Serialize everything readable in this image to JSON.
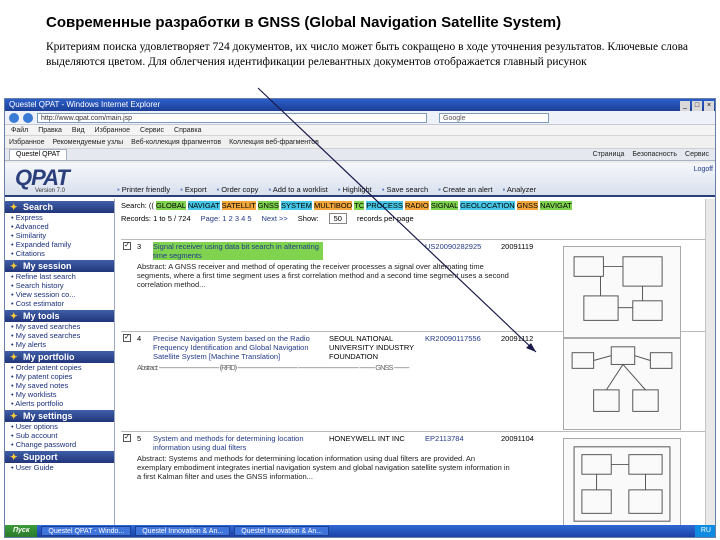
{
  "slide": {
    "title": "Современные разработки в  GNSS (Global Navigation Satellite System)",
    "description": "Критериям поиска удовлетворяет 724 документов, их число может быть сокращено в ходе уточнения результатов. Ключевые слова выделяются цветом. Для облегчения идентификации релевантных документов отображается главный рисунок"
  },
  "browser": {
    "window_title": "Questel QPAT - Windows Internet Explorer",
    "address": "http://www.qpat.com/main.jsp",
    "search_placeholder": "Google",
    "menu": [
      "Файл",
      "Правка",
      "Вид",
      "Избранное",
      "Сервис",
      "Справка"
    ],
    "favorites": [
      "Избранное",
      "Рекомендуемые узлы",
      "Веб-коллекция фрагментов",
      "Коллекция веб-фрагментов"
    ],
    "tab_label": "Questel QPAT",
    "tab_tools": [
      "Страница",
      "Безопасность",
      "Сервис"
    ]
  },
  "qpat": {
    "logo": "QPAT",
    "version": "Version 7.0",
    "top_link": "Logoff",
    "toolbar": [
      "Printer friendly",
      "Export",
      "Order copy",
      "Add to a worklist",
      "Highlight",
      "Save search",
      "Create an alert",
      "Analyzer"
    ]
  },
  "sidebar": {
    "sections": [
      {
        "head": "Search",
        "items": [
          "Express",
          "Advanced",
          "Similarity",
          "Expanded family",
          "Citations"
        ]
      },
      {
        "head": "My session",
        "items": [
          "Refine last search",
          "Search history",
          "View session co...",
          "Cost estimator"
        ]
      },
      {
        "head": "My tools",
        "items": [
          "My saved searches",
          "My saved searches",
          "My alerts"
        ]
      },
      {
        "head": "My portfolio",
        "items": [
          "Order patent copies",
          "My patent copies",
          "My saved notes",
          "My worklists",
          "Alerts portfolio"
        ]
      },
      {
        "head": "My settings",
        "items": [
          "User options",
          "Sub account",
          "Change password"
        ]
      },
      {
        "head": "Support",
        "items": [
          "User Guide"
        ]
      }
    ]
  },
  "search": {
    "query_prefix": "Search: ((",
    "terms": [
      "GLOBAL",
      "NAVIGAT",
      "SATELLIT",
      "GNSS",
      "SYSTEM",
      "MULTIBOD",
      "TC",
      "PROCESS",
      "RADIO",
      "SIGNAL",
      "GEOLOCATION",
      "GNSS",
      "NAVIGAT"
    ],
    "records_label": "Records: 1 to 5 / 724",
    "page_label": "Page: 1 2 3 4 5",
    "next_label": "Next >>",
    "show_label": "Show:",
    "show_value": "50",
    "records_per_page": "records per page"
  },
  "results": [
    {
      "num": "3",
      "title": "Signal receiver using data bit search in alternating time segments",
      "inventor": "",
      "patent": "US20090282925",
      "date": "20091119",
      "abstract": "Abstract: A GNSS receiver and method of operating the receiver processes a signal over alternating time segments, where a first time segment uses a first correlation method and a second time segment uses a second correlation method..."
    },
    {
      "num": "4",
      "title": "Precise Navigation System based on the Radio Frequency Identification and Global Navigation Satellite System [Machine Translation]",
      "inventor": "SEOUL NATIONAL UNIVERSITY INDUSTRY FOUNDATION",
      "patent": "KR20090117556",
      "date": "20091112",
      "abstract": "Abstract: ---------------------------------------- (RFID) ---------------------------------------- ---------------------------------------- ---------- GNSS ----------"
    },
    {
      "num": "5",
      "title": "System and methods for determining location information using dual filters",
      "inventor": "HONEYWELL INT INC",
      "patent": "EP2113784",
      "date": "20091104",
      "abstract": "Abstract: Systems and methods for determining location information using dual filters are provided. An exemplary embodiment integrates inertial navigation system and global navigation satellite system information in a first Kalman filter and uses the GNSS information..."
    }
  ],
  "taskbar": {
    "start": "Пуск",
    "items": [
      "Questel QPAT - Windo...",
      "Questel Innovation & An...",
      "Questel Innovation & An..."
    ],
    "tray": "RU"
  }
}
